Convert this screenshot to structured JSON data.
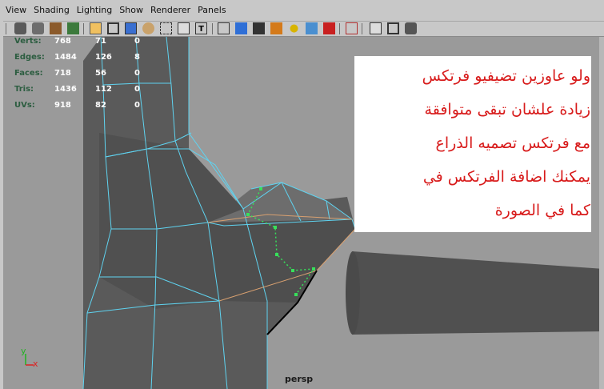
{
  "menu": [
    "View",
    "Shading",
    "Lighting",
    "Show",
    "Renderer",
    "Panels"
  ],
  "hud": {
    "rows": [
      {
        "label": "Verts:",
        "v1": "768",
        "v2": "71",
        "v3": "0"
      },
      {
        "label": "Edges:",
        "v1": "1484",
        "v2": "126",
        "v3": "8"
      },
      {
        "label": "Faces:",
        "v1": "718",
        "v2": "56",
        "v3": "0"
      },
      {
        "label": "Tris:",
        "v1": "1436",
        "v2": "112",
        "v3": "0"
      },
      {
        "label": "UVs:",
        "v1": "918",
        "v2": "82",
        "v3": "0"
      }
    ]
  },
  "note": {
    "lines": [
      "ولو عاوزين تضيفيو فرتكس",
      "زيادة علشان تبقى متوافقة",
      "مع فرتكس تصميه الذراع",
      "يمكنك اضافة الفرتكس في",
      "كما في الصورة"
    ]
  },
  "viewport": {
    "camera_label": "persp",
    "axis_y": "y",
    "axis_x": "x"
  },
  "colors": {
    "background": "#9a9a9a",
    "menubar": "#c8c8c8",
    "wireframe": "#5fd3f0",
    "selected_vertex": "#37e05a",
    "note_text": "#d81b1b",
    "hud_label": "#2c5d40"
  },
  "toolbar_icons": [
    "camera-attributes-icon",
    "camera-select-icon",
    "bookmark-icon",
    "image-plane-icon",
    "grid-icon",
    "film-gate-icon",
    "resolution-gate-icon",
    "field-chart-icon",
    "safe-action-icon",
    "safe-title-icon",
    "wireframe-icon",
    "smooth-shade-icon",
    "wireframe-on-shaded-icon",
    "textured-icon",
    "lights-icon",
    "shadows-icon",
    "high-quality-icon",
    "isolate-select-icon",
    "xray-icon",
    "xray-joints-icon",
    "backface-culling-icon"
  ]
}
